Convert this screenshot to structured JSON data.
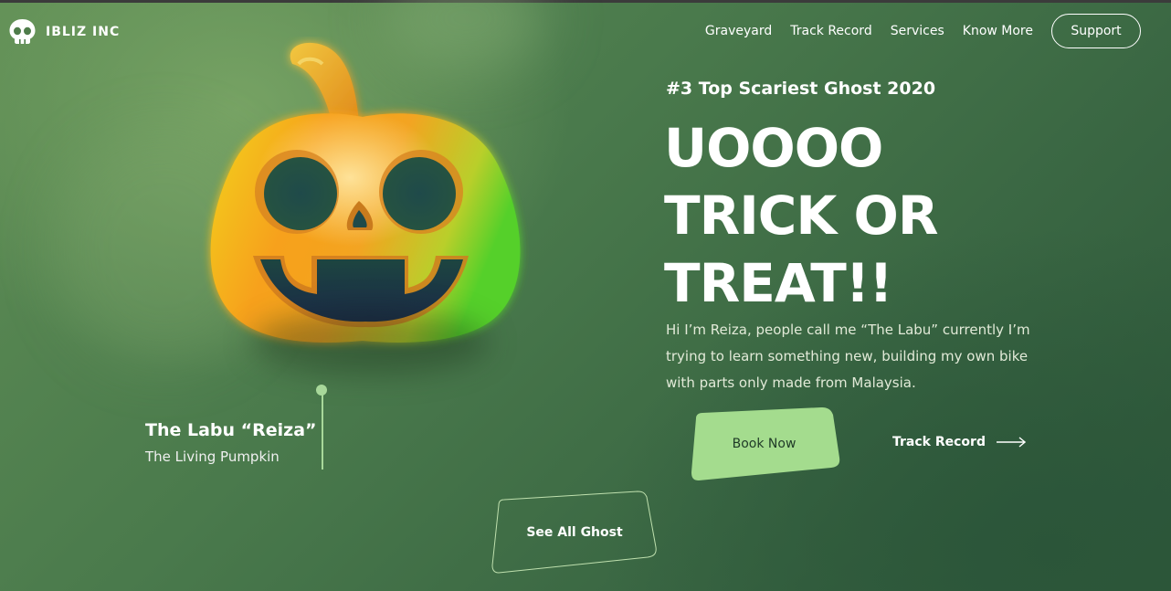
{
  "brand": {
    "name": "IBLIZ INC",
    "logo_icon": "skull-icon"
  },
  "nav": {
    "items": [
      {
        "label": "Graveyard"
      },
      {
        "label": "Track Record"
      },
      {
        "label": "Services"
      },
      {
        "label": "Know More"
      }
    ],
    "support_label": "Support"
  },
  "hero": {
    "kicker": "#3 Top Scariest Ghost 2020",
    "headline_lines": [
      "UOOOO",
      "TRICK OR",
      "TREAT!!"
    ],
    "description": "Hi I’m Reiza, people call me “The Labu” currently I’m trying to learn something new, building my own bike with parts only made from Malaysia.",
    "book_label": "Book Now",
    "track_label": "Track Record",
    "track_icon": "arrow-right-icon"
  },
  "feature": {
    "image_icon": "pumpkin-icon",
    "title": "The Labu “Reiza”",
    "subtitle": "The Living Pumpkin"
  },
  "see_all_label": "See All Ghost",
  "colors": {
    "accent_green": "#a4dc8e",
    "text_white": "#ffffff",
    "pumpkin_orange": "#f5a21c"
  }
}
